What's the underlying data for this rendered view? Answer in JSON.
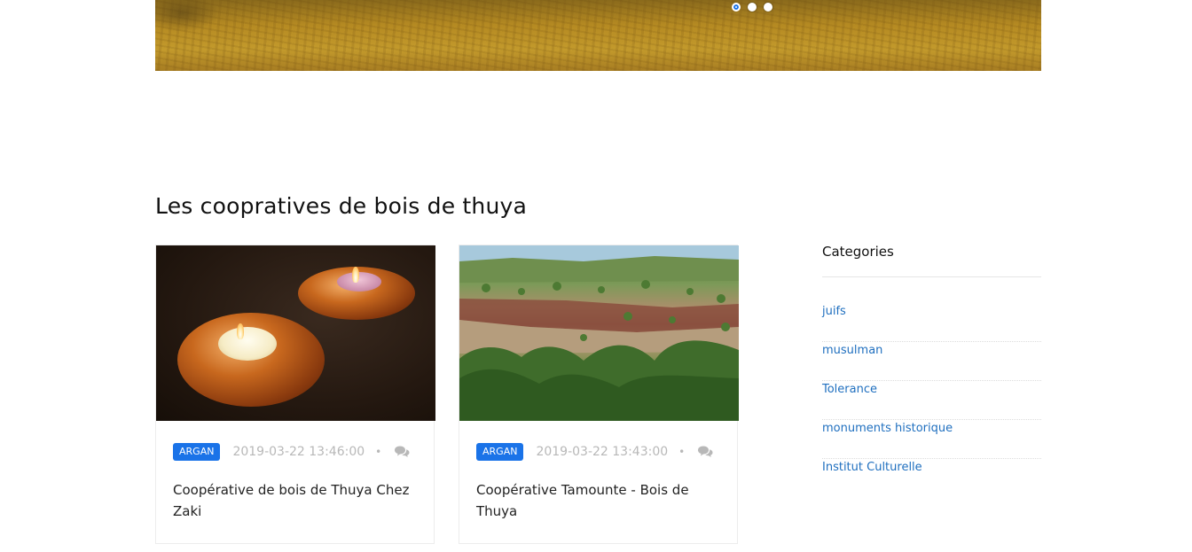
{
  "hero": {
    "slides": [
      {
        "active": true
      },
      {
        "active": false
      },
      {
        "active": false
      }
    ]
  },
  "section": {
    "title": "Les coopratives de bois de thuya"
  },
  "articles": [
    {
      "category": "ARGAN",
      "date": "2019-03-22 13:46:00",
      "separator": "•",
      "title": "Coopérative de bois de Thuya Chez Zaki",
      "image": "candles-thuya-wood"
    },
    {
      "category": "ARGAN",
      "date": "2019-03-22 13:43:00",
      "separator": "•",
      "title": "Coopérative Tamounte - Bois de Thuya",
      "image": "argan-landscape"
    }
  ],
  "sidebar": {
    "title": "Categories",
    "categories": [
      "juifs",
      "musulman",
      "Tolerance",
      "monuments historique",
      "Institut Culturelle"
    ]
  },
  "colors": {
    "accent": "#1a73e8",
    "link": "#1f6fbf",
    "meta": "#b8b8b8"
  }
}
